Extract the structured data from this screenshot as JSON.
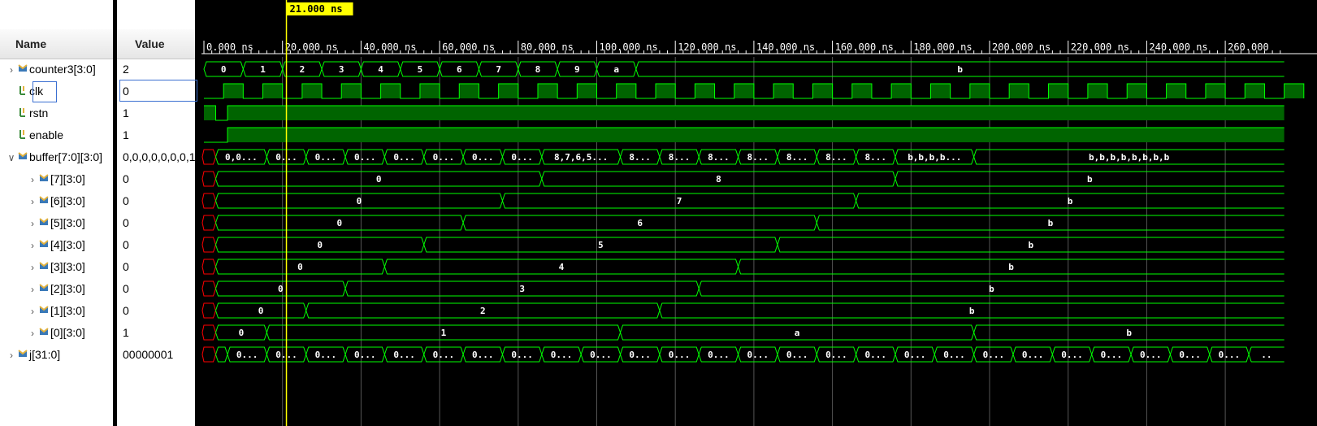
{
  "headers": {
    "name": "Name",
    "value": "Value"
  },
  "cursor": {
    "label": "21.000 ns",
    "time_ns": 21
  },
  "timeline": {
    "ticks": [
      {
        "t": 0,
        "label": "0.000 ns"
      },
      {
        "t": 20,
        "label": "20.000 ns"
      },
      {
        "t": 40,
        "label": "40.000 ns"
      },
      {
        "t": 60,
        "label": "60.000 ns"
      },
      {
        "t": 80,
        "label": "80.000 ns"
      },
      {
        "t": 100,
        "label": "100.000 ns"
      },
      {
        "t": 120,
        "label": "120.000 ns"
      },
      {
        "t": 140,
        "label": "140.000 ns"
      },
      {
        "t": 160,
        "label": "160.000 ns"
      },
      {
        "t": 180,
        "label": "180.000 ns"
      },
      {
        "t": 200,
        "label": "200.000 ns"
      },
      {
        "t": 220,
        "label": "220.000 ns"
      },
      {
        "t": 240,
        "label": "240.000 ns"
      },
      {
        "t": 260,
        "label": "260.000"
      }
    ]
  },
  "colors": {
    "wave": "#00ff00",
    "fill": "#006400",
    "cursor": "#ffff00",
    "glitch": "#ff0000",
    "grid": "#555555"
  },
  "signals": [
    {
      "name": "counter3[3:0]",
      "value": "2",
      "icon": "bus-icon",
      "expander": "collapsed",
      "indent": 0,
      "kind": "bus",
      "segments": [
        {
          "s": 0,
          "e": 10,
          "label": "0"
        },
        {
          "s": 10,
          "e": 20,
          "label": "1"
        },
        {
          "s": 20,
          "e": 30,
          "label": "2"
        },
        {
          "s": 30,
          "e": 40,
          "label": "3"
        },
        {
          "s": 40,
          "e": 50,
          "label": "4"
        },
        {
          "s": 50,
          "e": 60,
          "label": "5"
        },
        {
          "s": 60,
          "e": 70,
          "label": "6"
        },
        {
          "s": 70,
          "e": 80,
          "label": "7"
        },
        {
          "s": 80,
          "e": 90,
          "label": "8"
        },
        {
          "s": 90,
          "e": 100,
          "label": "9"
        },
        {
          "s": 100,
          "e": 110,
          "label": "a"
        },
        {
          "s": 110,
          "e": 275,
          "label": "b"
        }
      ]
    },
    {
      "name": "clk",
      "value": "0",
      "icon": "bit-icon",
      "expander": "none",
      "indent": 0,
      "kind": "clock",
      "period_ns": 10
    },
    {
      "name": "rstn",
      "value": "1",
      "icon": "bit-icon",
      "expander": "none",
      "indent": 0,
      "kind": "bit",
      "levels": [
        {
          "s": 0,
          "e": 3,
          "v": 1
        },
        {
          "s": 3,
          "e": 6,
          "v": 0
        },
        {
          "s": 6,
          "e": 275,
          "v": 1
        }
      ]
    },
    {
      "name": "enable",
      "value": "1",
      "icon": "bit-icon",
      "expander": "none",
      "indent": 0,
      "kind": "bit",
      "levels": [
        {
          "s": 0,
          "e": 6,
          "v": 0
        },
        {
          "s": 6,
          "e": 275,
          "v": 1
        }
      ]
    },
    {
      "name": "buffer[7:0][3:0]",
      "value": "0,0,0,0,0,0,0,1",
      "icon": "bus-icon",
      "expander": "expanded",
      "indent": 0,
      "kind": "bus",
      "xstart": 3,
      "segments": [
        {
          "s": 3,
          "e": 16,
          "label": "0,0..."
        },
        {
          "s": 16,
          "e": 26,
          "label": "0..."
        },
        {
          "s": 26,
          "e": 36,
          "label": "0..."
        },
        {
          "s": 36,
          "e": 46,
          "label": "0..."
        },
        {
          "s": 46,
          "e": 56,
          "label": "0..."
        },
        {
          "s": 56,
          "e": 66,
          "label": "0..."
        },
        {
          "s": 66,
          "e": 76,
          "label": "0..."
        },
        {
          "s": 76,
          "e": 86,
          "label": "0..."
        },
        {
          "s": 86,
          "e": 106,
          "label": "8,7,6,5..."
        },
        {
          "s": 106,
          "e": 116,
          "label": "8..."
        },
        {
          "s": 116,
          "e": 126,
          "label": "8..."
        },
        {
          "s": 126,
          "e": 136,
          "label": "8..."
        },
        {
          "s": 136,
          "e": 146,
          "label": "8..."
        },
        {
          "s": 146,
          "e": 156,
          "label": "8..."
        },
        {
          "s": 156,
          "e": 166,
          "label": "8..."
        },
        {
          "s": 166,
          "e": 176,
          "label": "8..."
        },
        {
          "s": 176,
          "e": 196,
          "label": "b,b,b,b..."
        },
        {
          "s": 196,
          "e": 275,
          "label": "b,b,b,b,b,b,b,b"
        }
      ]
    },
    {
      "name": "[7][3:0]",
      "value": "0",
      "icon": "bus-icon",
      "expander": "collapsed",
      "indent": 1,
      "kind": "bus",
      "xstart": 3,
      "segments": [
        {
          "s": 3,
          "e": 86,
          "label": "0"
        },
        {
          "s": 86,
          "e": 176,
          "label": "8"
        },
        {
          "s": 176,
          "e": 275,
          "label": "b"
        }
      ]
    },
    {
      "name": "[6][3:0]",
      "value": "0",
      "icon": "bus-icon",
      "expander": "collapsed",
      "indent": 1,
      "kind": "bus",
      "xstart": 3,
      "segments": [
        {
          "s": 3,
          "e": 76,
          "label": "0"
        },
        {
          "s": 76,
          "e": 166,
          "label": "7"
        },
        {
          "s": 166,
          "e": 275,
          "label": "b"
        }
      ]
    },
    {
      "name": "[5][3:0]",
      "value": "0",
      "icon": "bus-icon",
      "expander": "collapsed",
      "indent": 1,
      "kind": "bus",
      "xstart": 3,
      "segments": [
        {
          "s": 3,
          "e": 66,
          "label": "0"
        },
        {
          "s": 66,
          "e": 156,
          "label": "6"
        },
        {
          "s": 156,
          "e": 275,
          "label": "b"
        }
      ]
    },
    {
      "name": "[4][3:0]",
      "value": "0",
      "icon": "bus-icon",
      "expander": "collapsed",
      "indent": 1,
      "kind": "bus",
      "xstart": 3,
      "segments": [
        {
          "s": 3,
          "e": 56,
          "label": "0"
        },
        {
          "s": 56,
          "e": 146,
          "label": "5"
        },
        {
          "s": 146,
          "e": 275,
          "label": "b"
        }
      ]
    },
    {
      "name": "[3][3:0]",
      "value": "0",
      "icon": "bus-icon",
      "expander": "collapsed",
      "indent": 1,
      "kind": "bus",
      "xstart": 3,
      "segments": [
        {
          "s": 3,
          "e": 46,
          "label": "0"
        },
        {
          "s": 46,
          "e": 136,
          "label": "4"
        },
        {
          "s": 136,
          "e": 275,
          "label": "b"
        }
      ]
    },
    {
      "name": "[2][3:0]",
      "value": "0",
      "icon": "bus-icon",
      "expander": "collapsed",
      "indent": 1,
      "kind": "bus",
      "xstart": 3,
      "segments": [
        {
          "s": 3,
          "e": 36,
          "label": "0"
        },
        {
          "s": 36,
          "e": 126,
          "label": "3"
        },
        {
          "s": 126,
          "e": 275,
          "label": "b"
        }
      ]
    },
    {
      "name": "[1][3:0]",
      "value": "0",
      "icon": "bus-icon",
      "expander": "collapsed",
      "indent": 1,
      "kind": "bus",
      "xstart": 3,
      "segments": [
        {
          "s": 3,
          "e": 26,
          "label": "0"
        },
        {
          "s": 26,
          "e": 116,
          "label": "2"
        },
        {
          "s": 116,
          "e": 275,
          "label": "b"
        }
      ]
    },
    {
      "name": "[0][3:0]",
      "value": "1",
      "icon": "bus-icon",
      "expander": "collapsed",
      "indent": 1,
      "kind": "bus",
      "xstart": 3,
      "segments": [
        {
          "s": 3,
          "e": 16,
          "label": "0"
        },
        {
          "s": 16,
          "e": 106,
          "label": "1"
        },
        {
          "s": 106,
          "e": 196,
          "label": "a"
        },
        {
          "s": 196,
          "e": 275,
          "label": "b"
        }
      ]
    },
    {
      "name": "j[31:0]",
      "value": "00000001",
      "icon": "bus-icon",
      "expander": "collapsed",
      "indent": 0,
      "kind": "bus",
      "xstart": 3,
      "segments": [
        {
          "s": 3,
          "e": 6,
          "label": ""
        },
        {
          "s": 6,
          "e": 16,
          "label": "0..."
        },
        {
          "s": 16,
          "e": 26,
          "label": "0..."
        },
        {
          "s": 26,
          "e": 36,
          "label": "0..."
        },
        {
          "s": 36,
          "e": 46,
          "label": "0..."
        },
        {
          "s": 46,
          "e": 56,
          "label": "0..."
        },
        {
          "s": 56,
          "e": 66,
          "label": "0..."
        },
        {
          "s": 66,
          "e": 76,
          "label": "0..."
        },
        {
          "s": 76,
          "e": 86,
          "label": "0..."
        },
        {
          "s": 86,
          "e": 96,
          "label": "0..."
        },
        {
          "s": 96,
          "e": 106,
          "label": "0..."
        },
        {
          "s": 106,
          "e": 116,
          "label": "0..."
        },
        {
          "s": 116,
          "e": 126,
          "label": "0..."
        },
        {
          "s": 126,
          "e": 136,
          "label": "0..."
        },
        {
          "s": 136,
          "e": 146,
          "label": "0..."
        },
        {
          "s": 146,
          "e": 156,
          "label": "0..."
        },
        {
          "s": 156,
          "e": 166,
          "label": "0..."
        },
        {
          "s": 166,
          "e": 176,
          "label": "0..."
        },
        {
          "s": 176,
          "e": 186,
          "label": "0..."
        },
        {
          "s": 186,
          "e": 196,
          "label": "0..."
        },
        {
          "s": 196,
          "e": 206,
          "label": "0..."
        },
        {
          "s": 206,
          "e": 216,
          "label": "0..."
        },
        {
          "s": 216,
          "e": 226,
          "label": "0..."
        },
        {
          "s": 226,
          "e": 236,
          "label": "0..."
        },
        {
          "s": 236,
          "e": 246,
          "label": "0..."
        },
        {
          "s": 246,
          "e": 256,
          "label": "0..."
        },
        {
          "s": 256,
          "e": 266,
          "label": "0..."
        },
        {
          "s": 266,
          "e": 275,
          "label": ".."
        }
      ]
    }
  ]
}
